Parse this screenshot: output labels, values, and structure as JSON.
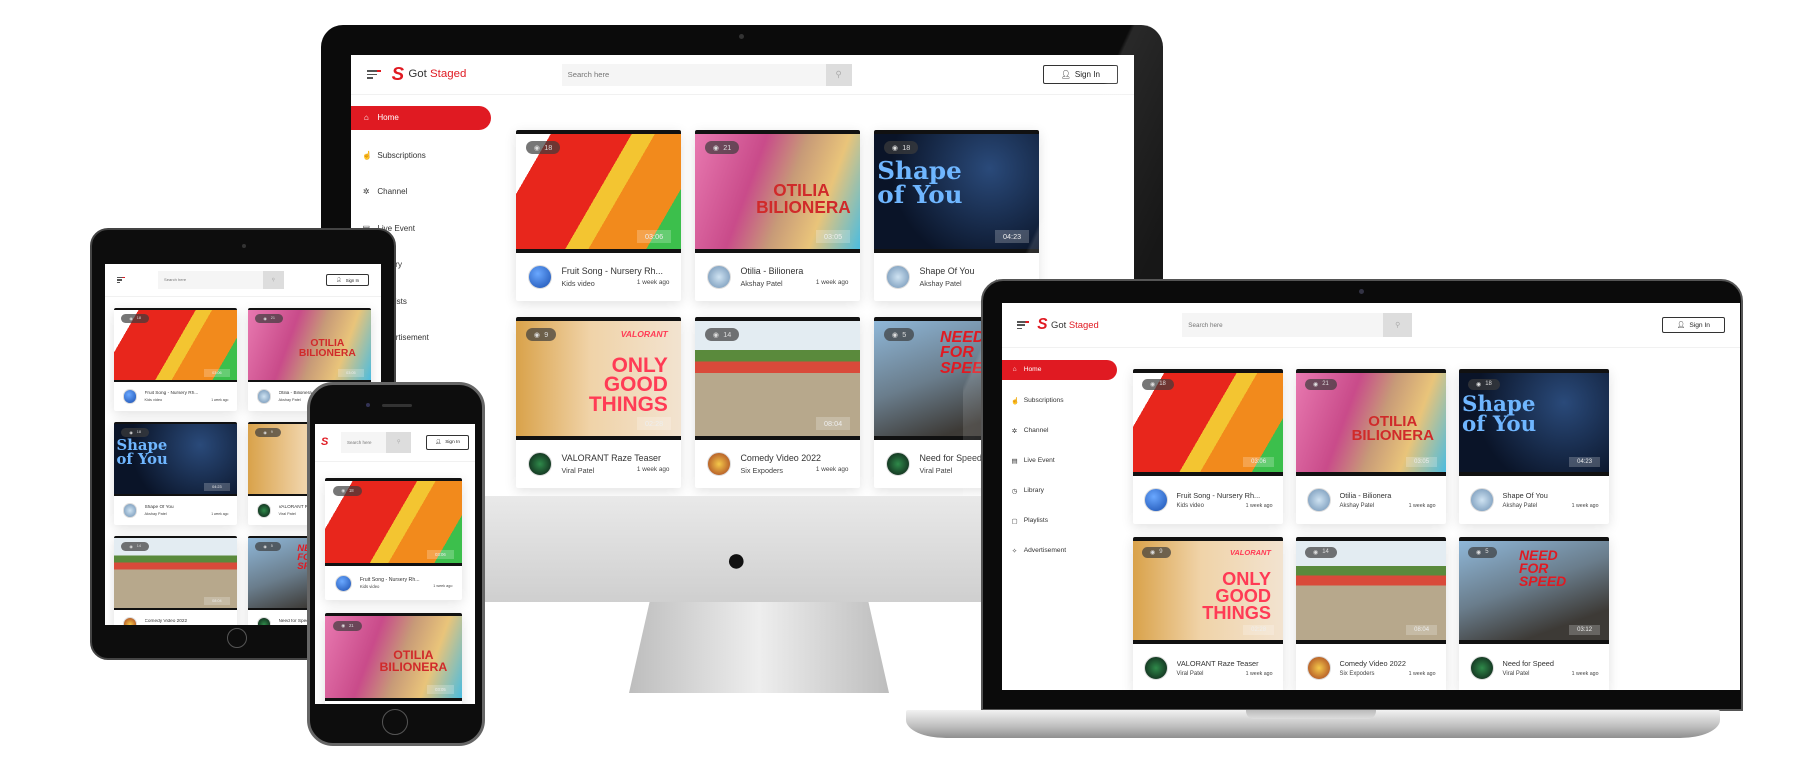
{
  "app": {
    "brand_prefix": "Got ",
    "brand_suffix": "Staged",
    "logo_letter": "S"
  },
  "header": {
    "search_placeholder": "Search here",
    "sign_in": "Sign In"
  },
  "sidebar": {
    "items": [
      {
        "label": "Home",
        "icon": "home-icon",
        "glyph": "⌂",
        "active": true
      },
      {
        "label": "Subscriptions",
        "icon": "hand-pointer-icon",
        "glyph": "☝"
      },
      {
        "label": "Channel",
        "icon": "channel-icon",
        "glyph": "✲"
      },
      {
        "label": "Live Event",
        "icon": "live-event-icon",
        "glyph": "▤"
      },
      {
        "label": "Library",
        "icon": "library-icon",
        "glyph": "◷"
      },
      {
        "label": "Playlists",
        "icon": "playlist-icon",
        "glyph": "▢"
      },
      {
        "label": "Advertisement",
        "icon": "advertisement-icon",
        "glyph": "✧"
      }
    ]
  },
  "videos": [
    {
      "title": "Fruit Song - Nursery Rh...",
      "channel": "Kids video",
      "ago": "1 week ago",
      "views": "18",
      "duration": "03:06",
      "thumb_text": "",
      "bg": "linear-gradient(120deg,#fff 0 15%,#e8261c 15% 50%,#f3c531 50% 60%,#f28a1c 60% 85%,#3cbf4c 85%)",
      "avatar": "radial-gradient(circle at 40% 35%,#6aa8ff,#1a4fb0)"
    },
    {
      "title": "Otilia - Bilionera",
      "channel": "Akshay Patel",
      "ago": "1 week ago",
      "views": "21",
      "duration": "03:05",
      "thumb_text": "OTILIA BILIONERA",
      "bg": "linear-gradient(110deg,#e879b0,#c94b8a 35%,#c79a78 55%,#e9c47a 75%,#4bbce0)",
      "avatar": "radial-gradient(circle,#cfe3f2,#6d90b3)",
      "tcolor": "#d02a2a"
    },
    {
      "title": "Shape Of You",
      "channel": "Akshay Patel",
      "ago": "1 week ago",
      "views": "18",
      "duration": "04:23",
      "thumb_text": "Shape of You",
      "bg": "radial-gradient(circle at 70% 30%,#2a4a7a,#0a1428 70%)",
      "avatar": "radial-gradient(circle,#cfe3f2,#6d90b3)",
      "tcolor": "#6fb6ff"
    },
    {
      "title": "VALORANT Raze Teaser",
      "channel": "Viral Patel",
      "ago": "1 week ago",
      "views": "9",
      "duration": "02:28",
      "thumb_text": "ONLY GOOD THINGS",
      "bg": "linear-gradient(90deg,#d9a24a,#f0d3a8 45%,#f2e3d0)",
      "avatar": "radial-gradient(circle,#2f8a4a,#0b1a14)",
      "tcolor": "#ff3b55",
      "badge": "VALORANT"
    },
    {
      "title": "Comedy Video 2022",
      "channel": "Six Expoders",
      "ago": "1 week ago",
      "views": "14",
      "duration": "08:04",
      "thumb_text": "",
      "bg": "linear-gradient(#e3ecf2 0 25%,#5a8a3c 25% 35%,#d94a3a 35% 45%,#b7a88c 45%)",
      "avatar": "radial-gradient(circle,#f4c84a,#a23b1d)"
    },
    {
      "title": "Need for Speed",
      "channel": "Viral Patel",
      "ago": "1 week ago",
      "views": "5",
      "duration": "03:12",
      "thumb_text": "NEED FOR SPEED",
      "bg": "linear-gradient(160deg,#8fb7d8,#6a7d8c 45%,#3d3a36 80%)",
      "avatar": "radial-gradient(circle,#2f8a4a,#0b1a14)",
      "tcolor": "#e01a22"
    }
  ],
  "tablet_order": [
    0,
    1,
    2,
    3,
    4,
    5
  ],
  "colors": {
    "accent": "#e01a22"
  }
}
